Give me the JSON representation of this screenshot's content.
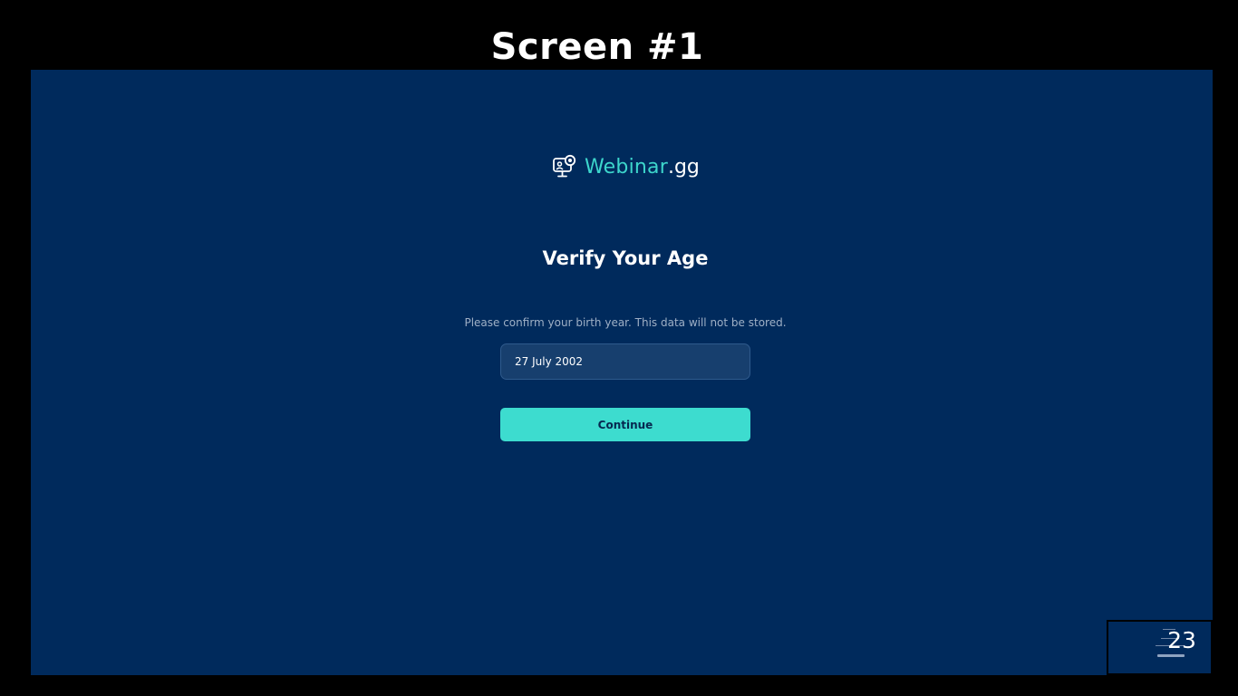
{
  "slide": {
    "heading": "Screen #1",
    "page_number": "23"
  },
  "brand": {
    "name": "Webinar",
    "tld": ".gg",
    "icon": "monitor-user-icon",
    "accent_color": "#3dd6cc"
  },
  "verify": {
    "title": "Verify Your Age",
    "subtitle": "Please confirm your birth year. This data will not be stored.",
    "birthdate_value": "27 July 2002",
    "continue_label": "Continue"
  },
  "colors": {
    "background": "#002a5c",
    "frame": "#000000",
    "button": "#3ddccf",
    "input_bg": "#173f6e"
  }
}
